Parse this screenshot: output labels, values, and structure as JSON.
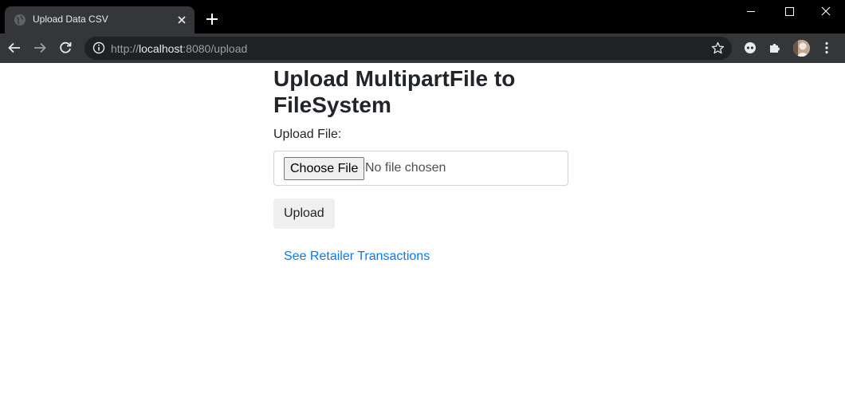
{
  "browser": {
    "tab_title": "Upload Data CSV",
    "url_scheme": "http://",
    "url_host": "localhost",
    "url_path": ":8080/upload",
    "icons": [
      "globe-icon",
      "close-icon",
      "plus-icon",
      "back-icon",
      "forward-icon",
      "reload-icon",
      "info-icon",
      "star-icon",
      "extension-icon",
      "puzzle-icon",
      "avatar",
      "more-icon",
      "minimize-icon",
      "maximize-icon",
      "window-close-icon"
    ]
  },
  "page": {
    "title": "Upload MultipartFile to FileSystem",
    "file_label": "Upload File:",
    "choose_file_label": "Choose File",
    "no_file_text": "No file chosen",
    "upload_button": "Upload",
    "link_text": "See Retailer Transactions"
  },
  "colors": {
    "link": "#007bff",
    "text": "#212529",
    "tab_bg": "#35363a",
    "titlebar_bg": "#000000"
  }
}
